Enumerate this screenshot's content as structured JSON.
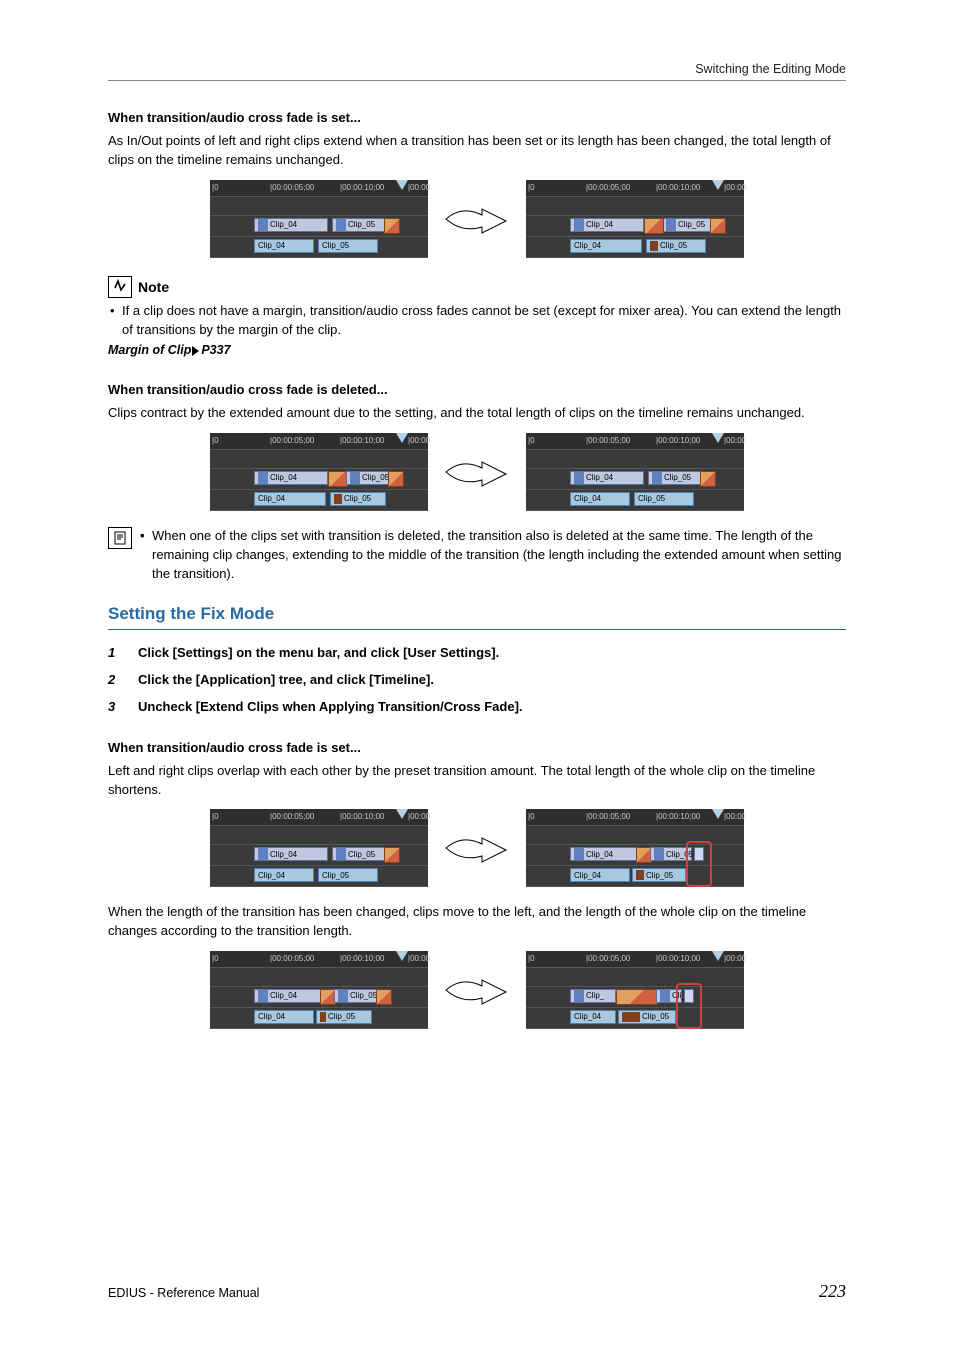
{
  "header": {
    "breadcrumb": "Switching the Editing Mode"
  },
  "sec1": {
    "title": "When transition/audio cross fade is set...",
    "body": "As In/Out points of left and right clips extend when a transition has been set or its length has been changed, the total length of clips on the timeline remains unchanged."
  },
  "timeline_labels": {
    "t0": "|0",
    "t5": "|00:00:05;00",
    "t10": "|00:00:10;00",
    "tend": "|00:00",
    "clip04": "Clip_04",
    "clip05": "Clip_05",
    "clip_short": "Clip_",
    "cli_short": "Cli_"
  },
  "note": {
    "label": "Note",
    "bullet": "If a clip does not have a margin, transition/audio cross fades cannot be set (except for mixer area). You can extend the length of transitions by the margin of the clip.",
    "xref_label": "Margin of Clip",
    "xref_page": "P337"
  },
  "sec2": {
    "title": "When transition/audio cross fade is deleted...",
    "body": "Clips contract by the extended amount due to the setting, and the total length of clips on the timeline remains unchanged."
  },
  "info": {
    "bullet": "When one of the clips set with transition is deleted, the transition also is deleted at the same time. The length of the remaining clip changes, extending to the middle of the transition (the length including the extended amount when setting the transition)."
  },
  "heading": "Setting the Fix Mode",
  "steps": [
    {
      "n": "1",
      "t": "Click [Settings] on the menu bar, and click [User Settings]."
    },
    {
      "n": "2",
      "t": "Click the [Application] tree, and click [Timeline]."
    },
    {
      "n": "3",
      "t": "Uncheck [Extend Clips when Applying Transition/Cross Fade]."
    }
  ],
  "sec3": {
    "title": "When transition/audio cross fade is set...",
    "body": "Left and right clips overlap with each other by the preset transition amount. The total length of the whole clip on the timeline shortens.",
    "body2": "When the length of the transition has been changed, clips move to the left, and the length of the whole clip on the timeline changes according to the transition length."
  },
  "footer": {
    "left": "EDIUS - Reference Manual",
    "page": "223"
  }
}
